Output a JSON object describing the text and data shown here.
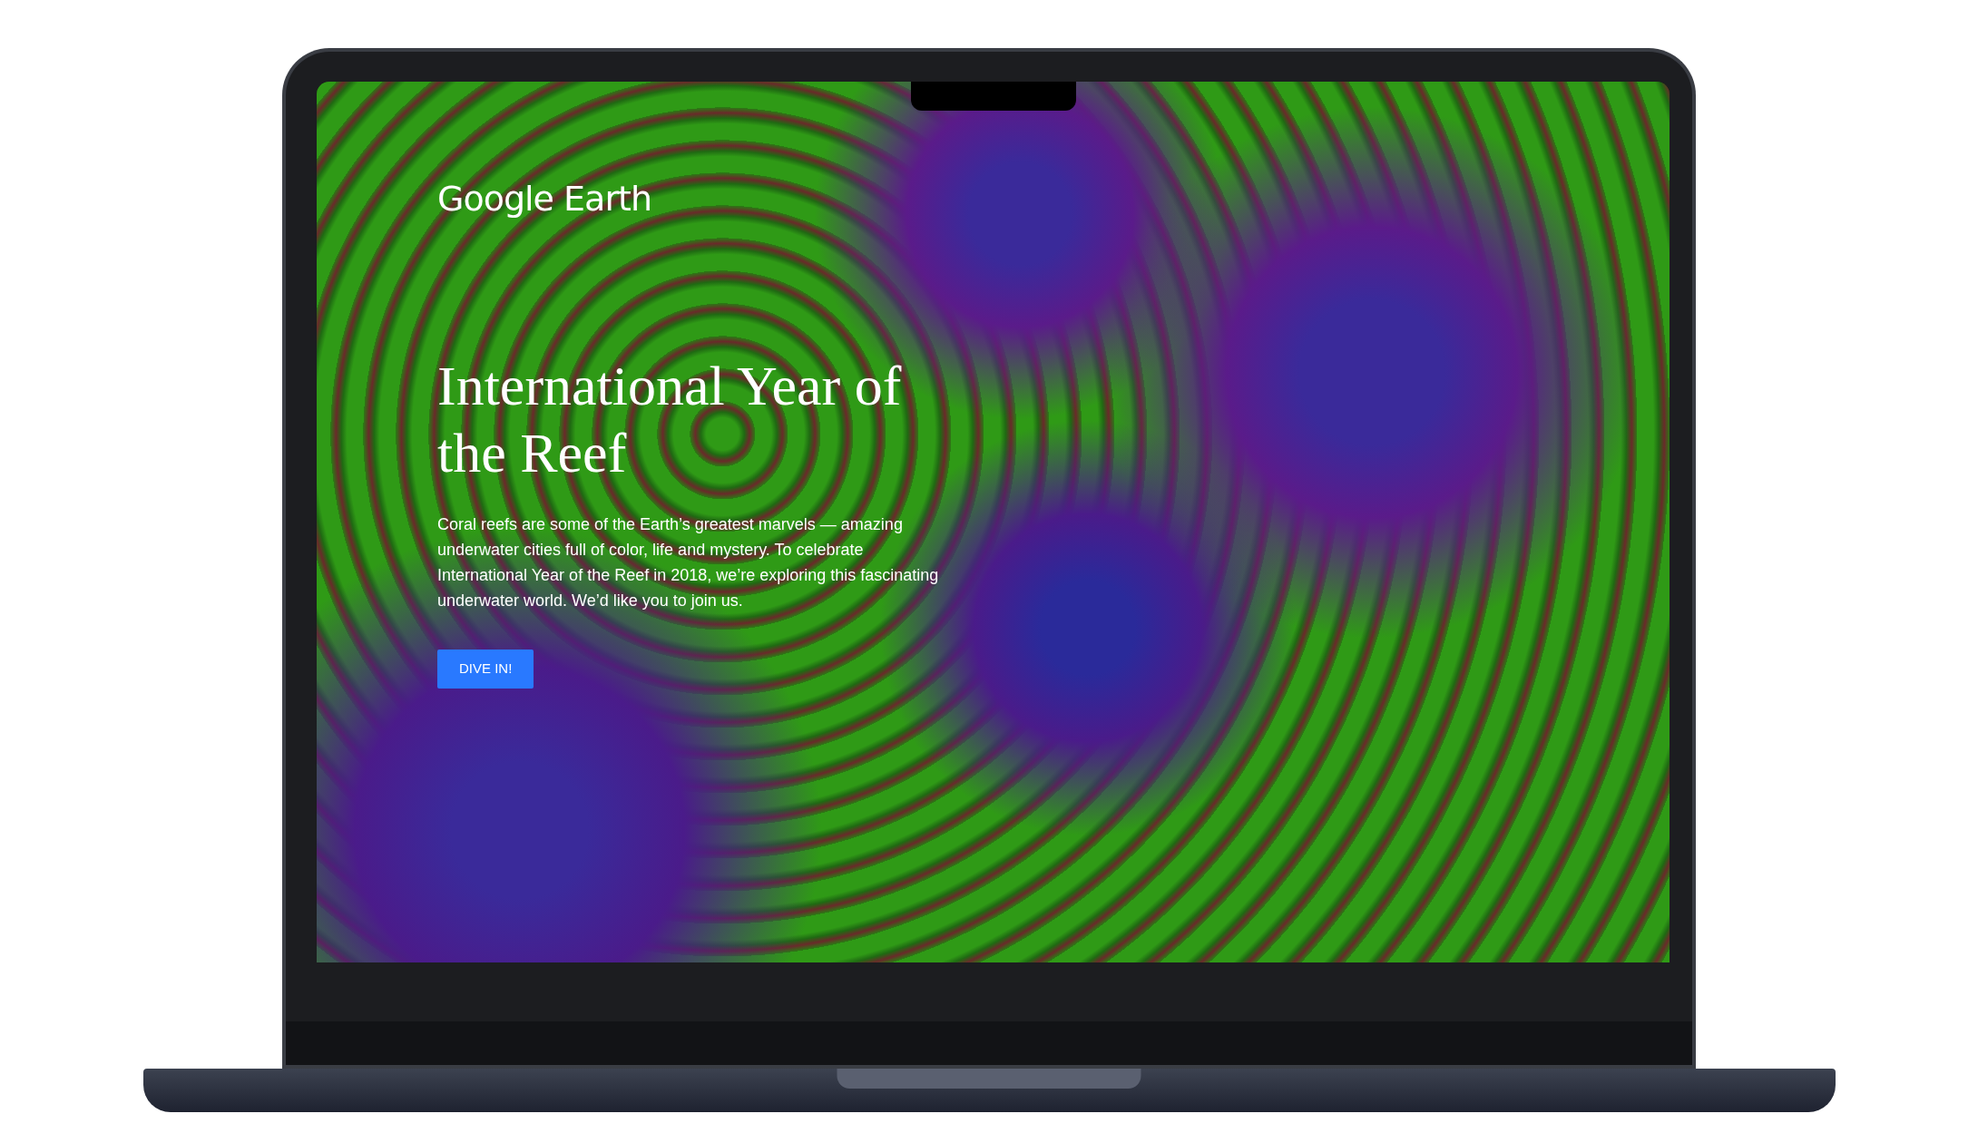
{
  "logo": "Google Earth",
  "hero": {
    "title": "International Year of the Reef",
    "body": "Coral reefs are some of the Earth’s greatest marvels — amazing underwater cities full of color, life and mystery. To celebrate International Year of the Reef in 2018, we’re exploring this fascinating underwater world. We’d like you to join us.",
    "button": "DIVE IN!"
  }
}
